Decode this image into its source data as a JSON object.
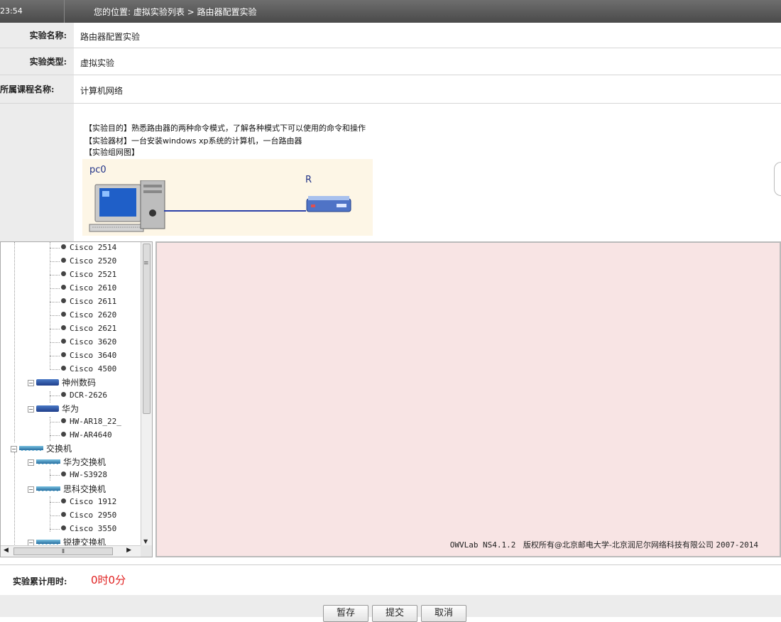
{
  "topbar": {
    "clock": "23:54",
    "breadcrumb": "您的位置: 虚拟实验列表 > 路由器配置实验"
  },
  "info": {
    "name_label": "实验名称:",
    "name_value": "路由器配置实验",
    "type_label": "实验类型:",
    "type_value": "虚拟实验",
    "course_label": "所属课程名称:",
    "course_value": "计算机网络"
  },
  "description": {
    "purpose": "【实验目的】熟悉路由器的两种命令模式，了解各种模式下可以使用的命令和操作",
    "equipment": "【实验器材】一台安装windows xp系统的计算机，一台路由器",
    "topology_title": "【实验组网图】"
  },
  "diagram": {
    "pc_label": "pc0",
    "router_label": "R"
  },
  "tree": {
    "cisco_routers": [
      "Cisco 2514",
      "Cisco 2520",
      "Cisco 2521",
      "Cisco 2610",
      "Cisco 2611",
      "Cisco 2620",
      "Cisco 2621",
      "Cisco 3620",
      "Cisco 3640",
      "Cisco 4500"
    ],
    "dcn_group": "神州数码",
    "dcn_items": [
      "DCR-2626"
    ],
    "huawei_group": "华为",
    "huawei_items": [
      "HW-AR18_22_",
      "HW-AR4640"
    ],
    "switch_root": "交换机",
    "huawei_switch_group": "华为交换机",
    "huawei_switch_items": [
      "HW-S3928"
    ],
    "cisco_switch_group": "思科交换机",
    "cisco_switch_items": [
      "Cisco 1912",
      "Cisco 2950",
      "Cisco 3550"
    ],
    "partial_group": "锐捷交换机"
  },
  "workspace": {
    "copyright_version": "OWVLab NS4.1.2",
    "copyright_text": "版权所有@北京邮电大学-北京润尼尔网络科技有限公司",
    "copyright_years": "2007-2014"
  },
  "timer": {
    "label": "实验累计用时:",
    "value": "0时0分"
  },
  "buttons": {
    "save": "暂存",
    "submit": "提交",
    "cancel": "取消"
  },
  "colors": {
    "timer": "#e02020",
    "workspace_bg": "#f8e4e4",
    "link": "#2b3fa8"
  }
}
